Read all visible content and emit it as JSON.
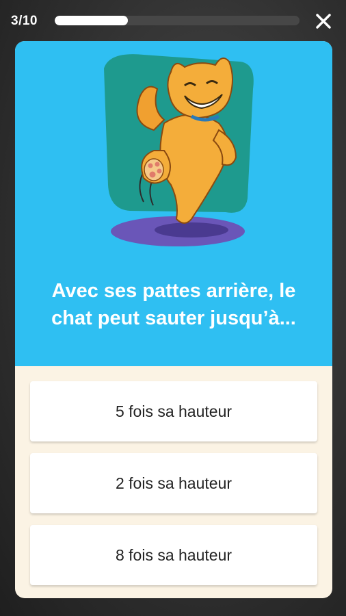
{
  "header": {
    "progress_label": "3/10",
    "progress_fraction": 0.3,
    "close_icon": "close-icon"
  },
  "question": {
    "text": "Avec ses pattes arrière, le chat peut sauter jusqu’à..."
  },
  "answers": [
    {
      "label": "5 fois sa hauteur"
    },
    {
      "label": "2 fois sa hauteur"
    },
    {
      "label": "8 fois sa hauteur"
    }
  ],
  "colors": {
    "card_top": "#2fbff2",
    "card_bottom": "#fbf3e4",
    "progress_fill": "#ffffff",
    "progress_track": "#474747"
  }
}
